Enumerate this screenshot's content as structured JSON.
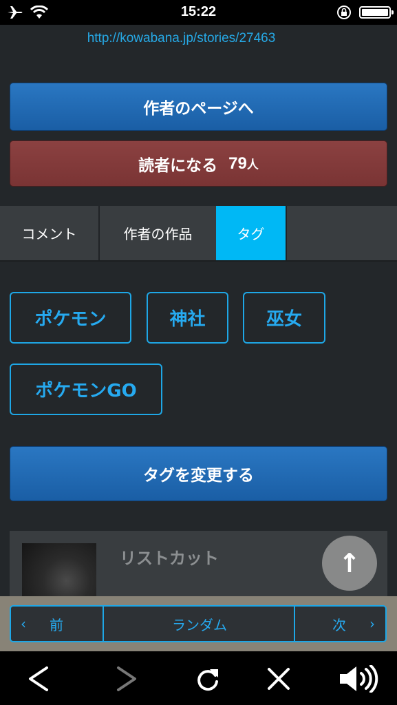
{
  "status_bar": {
    "time": "15:22"
  },
  "page": {
    "url": "http://kowabana.jp/stories/27463"
  },
  "author_page_button": {
    "label": "作者のページへ"
  },
  "follow_button": {
    "label": "読者になる",
    "count": "79",
    "unit": "人"
  },
  "tabs": [
    {
      "label": "コメント",
      "active": false
    },
    {
      "label": "作者の作品",
      "active": false
    },
    {
      "label": "タグ",
      "active": true
    }
  ],
  "tags": [
    "ポケモン",
    "神社",
    "巫女",
    "ポケモンGO"
  ],
  "change_tags_button": {
    "label": "タグを変更する"
  },
  "story_card": {
    "title": "リストカット"
  },
  "pager": {
    "prev_chevron": "‹",
    "prev": "前",
    "random": "ランダム",
    "next": "次",
    "next_chevron": "›"
  },
  "scroll_top_button": {
    "icon": "↑"
  },
  "toolbar": {
    "icons": [
      "back-icon",
      "forward-icon",
      "reload-icon",
      "close-icon",
      "speaker-icon"
    ]
  },
  "colors": {
    "accent": "#00b8f5",
    "primary_button": "#1f68b3",
    "follow_button": "#833c3c",
    "background": "#23272a"
  }
}
